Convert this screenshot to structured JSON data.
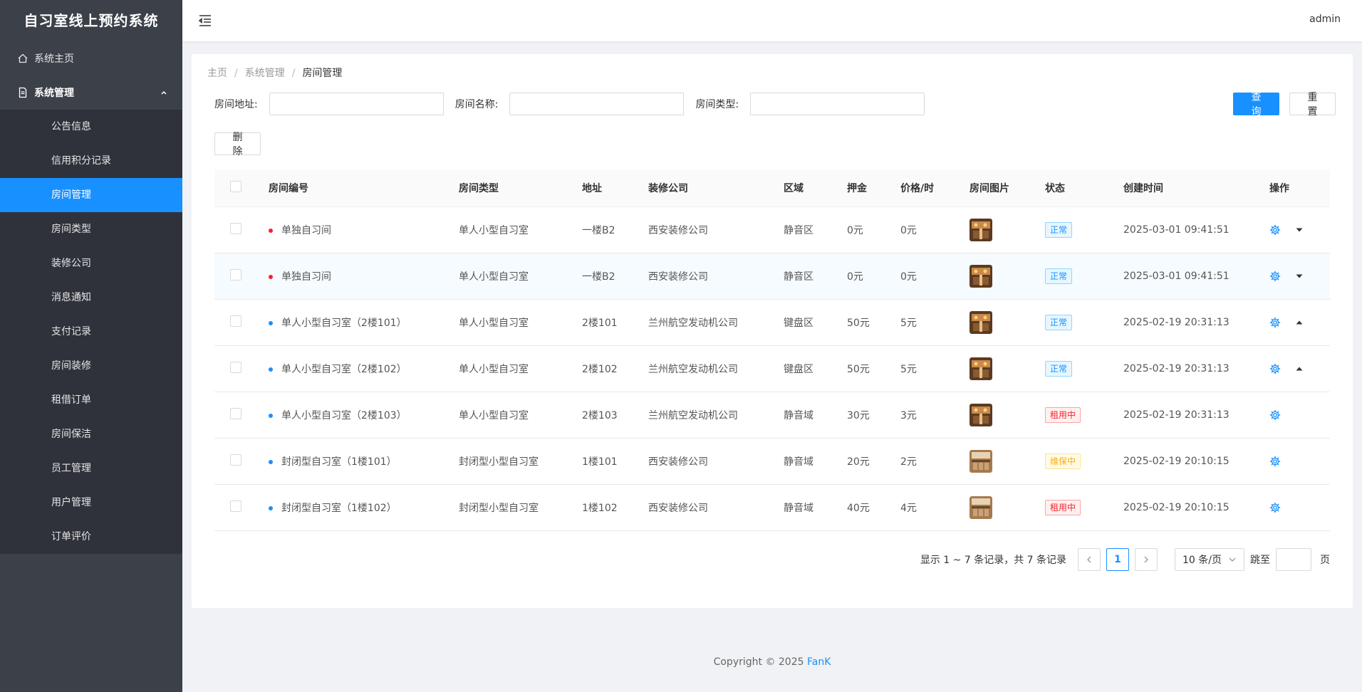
{
  "sidebar": {
    "title": "自习室线上预约系统",
    "home": "系统主页",
    "group": "系统管理",
    "items": [
      {
        "label": "公告信息",
        "active": false
      },
      {
        "label": "信用积分记录",
        "active": false
      },
      {
        "label": "房间管理",
        "active": true
      },
      {
        "label": "房间类型",
        "active": false
      },
      {
        "label": "装修公司",
        "active": false
      },
      {
        "label": "消息通知",
        "active": false
      },
      {
        "label": "支付记录",
        "active": false
      },
      {
        "label": "房间装修",
        "active": false
      },
      {
        "label": "租借订单",
        "active": false
      },
      {
        "label": "房间保洁",
        "active": false
      },
      {
        "label": "员工管理",
        "active": false
      },
      {
        "label": "用户管理",
        "active": false
      },
      {
        "label": "订单评价",
        "active": false
      }
    ]
  },
  "header": {
    "user": "admin"
  },
  "breadcrumb": {
    "home": "主页",
    "section": "系统管理",
    "current": "房间管理"
  },
  "search": {
    "address_label": "房间地址:",
    "name_label": "房间名称:",
    "type_label": "房间类型:",
    "query_button": "查 询",
    "reset_button": "重 置"
  },
  "toolbar": {
    "delete_button": "删 除"
  },
  "table": {
    "columns": [
      "房间编号",
      "房间类型",
      "地址",
      "装修公司",
      "区域",
      "押金",
      "价格/时",
      "房间图片",
      "状态",
      "创建时间",
      "操作"
    ],
    "rows": [
      {
        "no": "单独自习间",
        "dot": "#f5222d",
        "type": "单人小型自习室",
        "addr": "一楼B2",
        "company": "西安装修公司",
        "area": "静音区",
        "deposit": "0元",
        "price": "0元",
        "img": "warm",
        "status": "正常",
        "status_kind": "normal",
        "time": "2025-03-01 09:41:51",
        "arrow": "down",
        "highlight": false
      },
      {
        "no": "单独自习间",
        "dot": "#f5222d",
        "type": "单人小型自习室",
        "addr": "一楼B2",
        "company": "西安装修公司",
        "area": "静音区",
        "deposit": "0元",
        "price": "0元",
        "img": "warm",
        "status": "正常",
        "status_kind": "normal",
        "time": "2025-03-01 09:41:51",
        "arrow": "down",
        "highlight": true
      },
      {
        "no": "单人小型自习室（2楼101）",
        "dot": "#1890ff",
        "type": "单人小型自习室",
        "addr": "2楼101",
        "company": "兰州航空发动机公司",
        "area": "键盘区",
        "deposit": "50元",
        "price": "5元",
        "img": "warm",
        "status": "正常",
        "status_kind": "normal",
        "time": "2025-02-19 20:31:13",
        "arrow": "up",
        "highlight": false
      },
      {
        "no": "单人小型自习室（2楼102）",
        "dot": "#1890ff",
        "type": "单人小型自习室",
        "addr": "2楼102",
        "company": "兰州航空发动机公司",
        "area": "键盘区",
        "deposit": "50元",
        "price": "5元",
        "img": "warm",
        "status": "正常",
        "status_kind": "normal",
        "time": "2025-02-19 20:31:13",
        "arrow": "up",
        "highlight": false
      },
      {
        "no": "单人小型自习室（2楼103）",
        "dot": "#1890ff",
        "type": "单人小型自习室",
        "addr": "2楼103",
        "company": "兰州航空发动机公司",
        "area": "静音域",
        "deposit": "30元",
        "price": "3元",
        "img": "warm",
        "status": "租用中",
        "status_kind": "rent",
        "time": "2025-02-19 20:31:13",
        "arrow": "",
        "highlight": false
      },
      {
        "no": "封闭型自习室（1楼101）",
        "dot": "#1890ff",
        "type": "封闭型小型自习室",
        "addr": "1楼101",
        "company": "西安装修公司",
        "area": "静音域",
        "deposit": "20元",
        "price": "2元",
        "img": "wood",
        "status": "维保中",
        "status_kind": "clean",
        "time": "2025-02-19 20:10:15",
        "arrow": "",
        "highlight": false
      },
      {
        "no": "封闭型自习室（1楼102）",
        "dot": "#1890ff",
        "type": "封闭型小型自习室",
        "addr": "1楼102",
        "company": "西安装修公司",
        "area": "静音域",
        "deposit": "40元",
        "price": "4元",
        "img": "wood",
        "status": "租用中",
        "status_kind": "rent",
        "time": "2025-02-19 20:10:15",
        "arrow": "",
        "highlight": false
      }
    ]
  },
  "pagination": {
    "summary": "显示 1 ~ 7 条记录，共 7 条记录",
    "current_page": "1",
    "page_size": "10 条/页",
    "jump_label": "跳至",
    "page_suffix": "页"
  },
  "footer": {
    "text": "Copyright © 2025",
    "brand": "FanK"
  }
}
